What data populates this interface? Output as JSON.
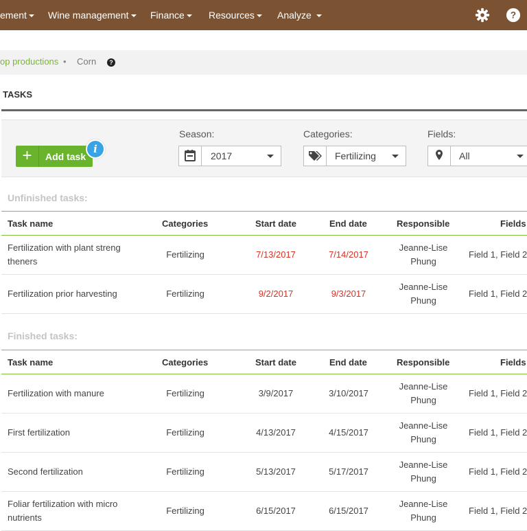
{
  "nav": {
    "items": [
      {
        "label": "ement"
      },
      {
        "label": "Wine management"
      },
      {
        "label": "Finance"
      },
      {
        "label": "Resources"
      },
      {
        "label": "Analyze"
      }
    ],
    "icons": [
      "gear-icon",
      "help-circle-icon"
    ]
  },
  "breadcrumb": {
    "parent": "op productions",
    "separator": "•",
    "current": "Corn",
    "help": "?"
  },
  "section": {
    "title": "TASKS"
  },
  "filters": {
    "add_task_label": "Add task",
    "add_icon": "+",
    "info_icon": "i",
    "season": {
      "label": "Season:",
      "value": "2017",
      "icon": "calendar-icon"
    },
    "categories": {
      "label": "Categories:",
      "value": "Fertilizing",
      "icon": "tags-icon"
    },
    "fields": {
      "label": "Fields:",
      "value": "All",
      "icon": "map-pin-icon"
    }
  },
  "columns": [
    "Task name",
    "Categories",
    "Start date",
    "End date",
    "Responsible",
    "Fields"
  ],
  "unfinished": {
    "title": "Unfinished tasks:",
    "rows": [
      {
        "name": "Fertilization with plant streng theners",
        "category": "Fertilizing",
        "start": "7/13/2017",
        "end": "7/14/2017",
        "responsible": "Jeanne-Lise Phung",
        "fields": "Field 1, Field 2"
      },
      {
        "name": "Fertilization prior harvesting",
        "category": "Fertilizing",
        "start": "9/2/2017",
        "end": "9/3/2017",
        "responsible": "Jeanne-Lise Phung",
        "fields": "Field 1, Field 2"
      }
    ]
  },
  "finished": {
    "title": "Finished tasks:",
    "rows": [
      {
        "name": "Fertilization with manure",
        "category": "Fertilizing",
        "start": "3/9/2017",
        "end": "3/10/2017",
        "responsible": "Jeanne-Lise Phung",
        "fields": "Field 1, Field 2"
      },
      {
        "name": "First fertilization",
        "category": "Fertilizing",
        "start": "4/13/2017",
        "end": "4/15/2017",
        "responsible": "Jeanne-Lise Phung",
        "fields": "Field 1, Field 2"
      },
      {
        "name": "Second fertilization",
        "category": "Fertilizing",
        "start": "5/13/2017",
        "end": "5/17/2017",
        "responsible": "Jeanne-Lise Phung",
        "fields": "Field 1, Field 2"
      },
      {
        "name": "Foliar fertilization with micro nutrients",
        "category": "Fertilizing",
        "start": "6/15/2017",
        "end": "6/15/2017",
        "responsible": "Jeanne-Lise Phung",
        "fields": "Field 1, Field 2"
      }
    ]
  },
  "colors": {
    "nav_bg": "#7b5333",
    "accent_green": "#6ab42d",
    "overdue_red": "#d93025",
    "info_blue": "#3aa3e3"
  }
}
